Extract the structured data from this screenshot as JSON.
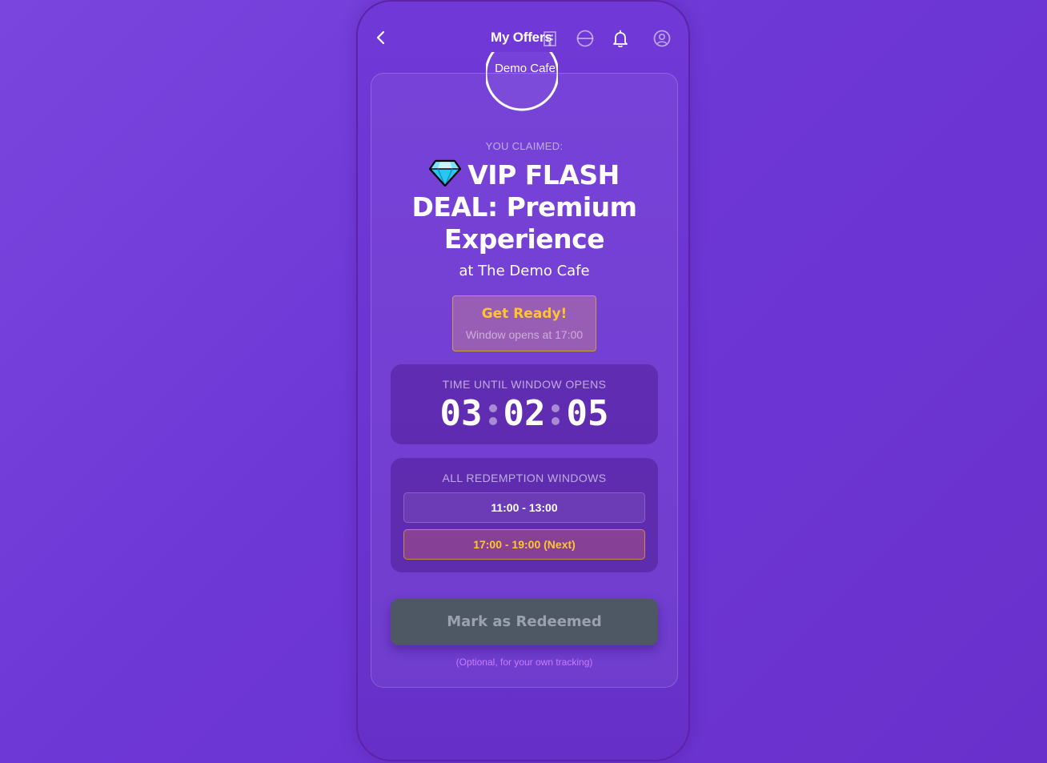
{
  "header": {
    "title": "My Offers",
    "back_icon": "chevron-left-icon",
    "icons": [
      "building-icon",
      "globe-icon",
      "bell-icon",
      "user-circle-icon"
    ]
  },
  "offer": {
    "merchant_logo_text": "Demo Cafe",
    "claimed_label": "YOU CLAIMED:",
    "emoji_icon": "gem-icon",
    "title": "VIP FLASH DEAL: Premium Experience",
    "venue": "at The Demo Cafe"
  },
  "status": {
    "title": "Get Ready!",
    "subtitle": "Window opens at 17:00"
  },
  "countdown": {
    "label": "TIME UNTIL WINDOW OPENS",
    "hours": "03",
    "minutes": "02",
    "seconds": "05"
  },
  "redemption_windows": {
    "label": "ALL REDEMPTION WINDOWS",
    "slots": [
      "11:00 - 13:00",
      "17:00 - 19:00 (Next)"
    ]
  },
  "action": {
    "redeem_label": "Mark as Redeemed",
    "note": "(Optional, for your own tracking)"
  },
  "colors": {
    "background": "#7040d8",
    "accent_yellow": "#ffc42e",
    "button_disabled": "#4e5764",
    "note_purple": "#c77dff"
  }
}
